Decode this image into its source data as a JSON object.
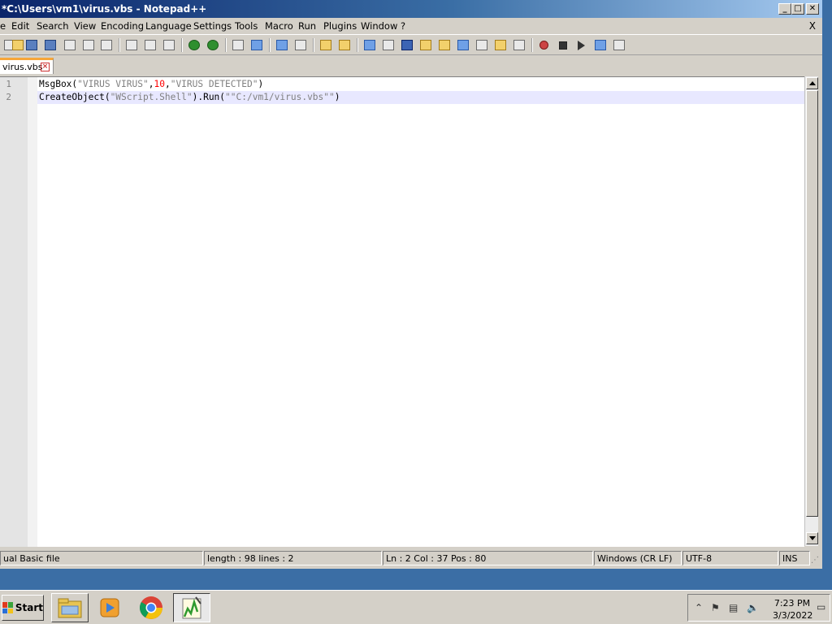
{
  "window": {
    "title": "*C:\\Users\\vm1\\virus.vbs - Notepad++",
    "minimize": "_",
    "maximize": "□",
    "close": "✕"
  },
  "menu": {
    "items": [
      "e",
      "Edit",
      "Search",
      "View",
      "Encoding",
      "Language",
      "Settings",
      "Tools",
      "Macro",
      "Run",
      "Plugins",
      "Window",
      "?"
    ],
    "close_doc": "X"
  },
  "toolbar": {
    "icons": [
      "new-file-icon",
      "open-file-icon",
      "save-icon",
      "save-all-icon",
      "close-icon",
      "close-all-icon",
      "print-icon",
      "cut-icon",
      "copy-icon",
      "paste-icon",
      "undo-icon",
      "redo-icon",
      "find-icon",
      "replace-icon",
      "zoom-in-icon",
      "zoom-out-icon",
      "sync-vertical-icon",
      "sync-horizontal-icon",
      "word-wrap-icon",
      "show-all-chars-icon",
      "indent-guide-icon",
      "document-map-icon",
      "function-list-icon",
      "folder-workspace-icon",
      "monitor-icon",
      "eye-icon",
      "record-macro-icon",
      "stop-macro-icon",
      "play-macro-icon",
      "run-macro-multiple-icon",
      "save-macro-icon"
    ]
  },
  "tab": {
    "label": "virus.vbs",
    "close": "×"
  },
  "editor": {
    "line_numbers": [
      "1",
      "2"
    ],
    "lines": [
      [
        {
          "t": "MsgBox(",
          "c": "plain"
        },
        {
          "t": "\"VIRUS VIRUS\"",
          "c": "str"
        },
        {
          "t": ",",
          "c": "plain"
        },
        {
          "t": "10",
          "c": "num"
        },
        {
          "t": ",",
          "c": "plain"
        },
        {
          "t": "\"VIRUS DETECTED\"",
          "c": "str"
        },
        {
          "t": ")",
          "c": "plain"
        }
      ],
      [
        {
          "t": "CreateObject(",
          "c": "plain"
        },
        {
          "t": "\"WScript.Shell\"",
          "c": "str"
        },
        {
          "t": ").Run(",
          "c": "plain"
        },
        {
          "t": "\"\"C:/vm1/virus.vbs\"\"",
          "c": "str"
        },
        {
          "t": ")",
          "c": "plain"
        }
      ]
    ]
  },
  "status": {
    "language": "ual Basic file",
    "length": "length : 98    lines : 2",
    "position": "Ln : 2    Col : 37    Pos : 80",
    "eol": "Windows (CR LF)",
    "encoding": "UTF-8",
    "mode": "INS"
  },
  "taskbar": {
    "start": "Start",
    "apps": [
      "file-explorer-icon",
      "media-player-icon",
      "chrome-icon",
      "notepad-plus-plus-icon"
    ],
    "tray": {
      "time": "7:23 PM",
      "date": "3/3/2022"
    }
  }
}
